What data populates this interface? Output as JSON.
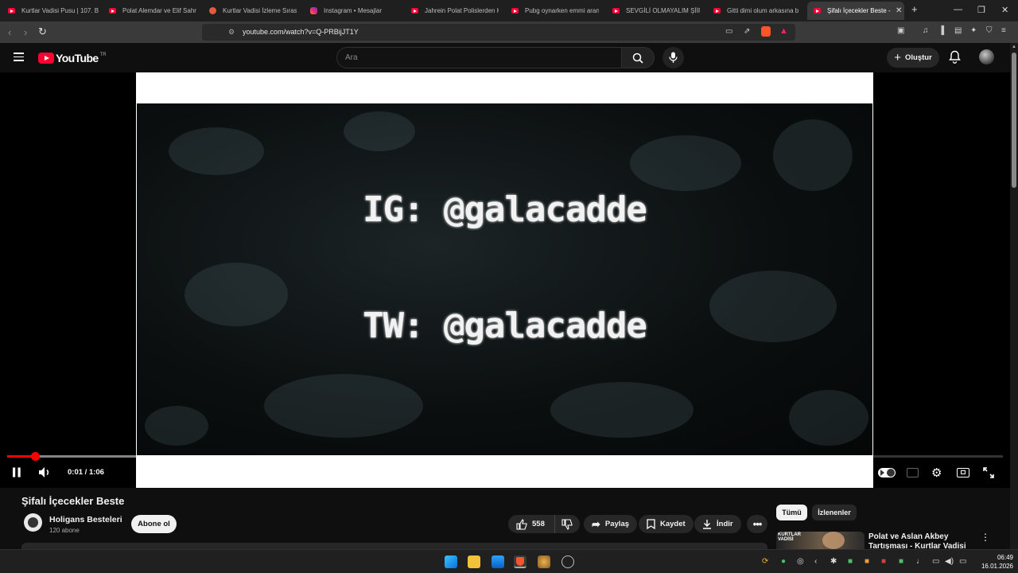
{
  "browser": {
    "tabs": [
      {
        "label": "Kurtlar Vadisi Pusu | 107. B",
        "icon": "youtube-icon"
      },
      {
        "label": "Polat Alemdar ve Elif Sahn",
        "icon": "youtube-icon"
      },
      {
        "label": "Kurtlar Vadisi İzleme Sırası",
        "icon": "reddit-icon"
      },
      {
        "label": "Instagram • Mesajlar",
        "icon": "instagram-icon"
      },
      {
        "label": "Jahrein Polat Polislerden K",
        "icon": "youtube-icon"
      },
      {
        "label": "Pubg oynarken emmi aran",
        "icon": "youtube-icon"
      },
      {
        "label": "SEVGİLİ OLMAYALIM ŞİİRİ",
        "icon": "youtube-icon"
      },
      {
        "label": "Gitti dimi olum arkasına b",
        "icon": "youtube-icon"
      },
      {
        "label": "Şifalı İçecekler Beste -",
        "icon": "youtube-icon",
        "active": true
      }
    ],
    "url": "youtube.com/watch?v=Q-PRBijJT1Y"
  },
  "youtube": {
    "logo_text": "YouTube",
    "region": "TR",
    "search_placeholder": "Ara",
    "create_label": "Oluştur"
  },
  "player": {
    "video_line1": "IG: @galacadde",
    "video_line2": "TW: @galacadde",
    "current_time": "0:01",
    "separator": "/",
    "duration": "1:06",
    "progress_played_fraction": 0.028,
    "progress_buffered_fraction": 0.48
  },
  "video": {
    "title": "Şifalı İçecekler Beste",
    "channel_name": "Holigans Besteleri",
    "subscribers": "120 abone",
    "subscribe_label": "Abone ol",
    "likes": "558",
    "share_label": "Paylaş",
    "save_label": "Kaydet",
    "download_label": "İndir"
  },
  "sidebar": {
    "chips": [
      "Tümü",
      "İzlenenler"
    ],
    "recommendation": {
      "title": "Polat ve Aslan Akbey Tartışması - Kurtlar Vadisi",
      "thumb_text": "KURTLAR VADİSİ"
    }
  },
  "taskbar": {
    "time": "06:49",
    "date": "16.01.2026"
  }
}
